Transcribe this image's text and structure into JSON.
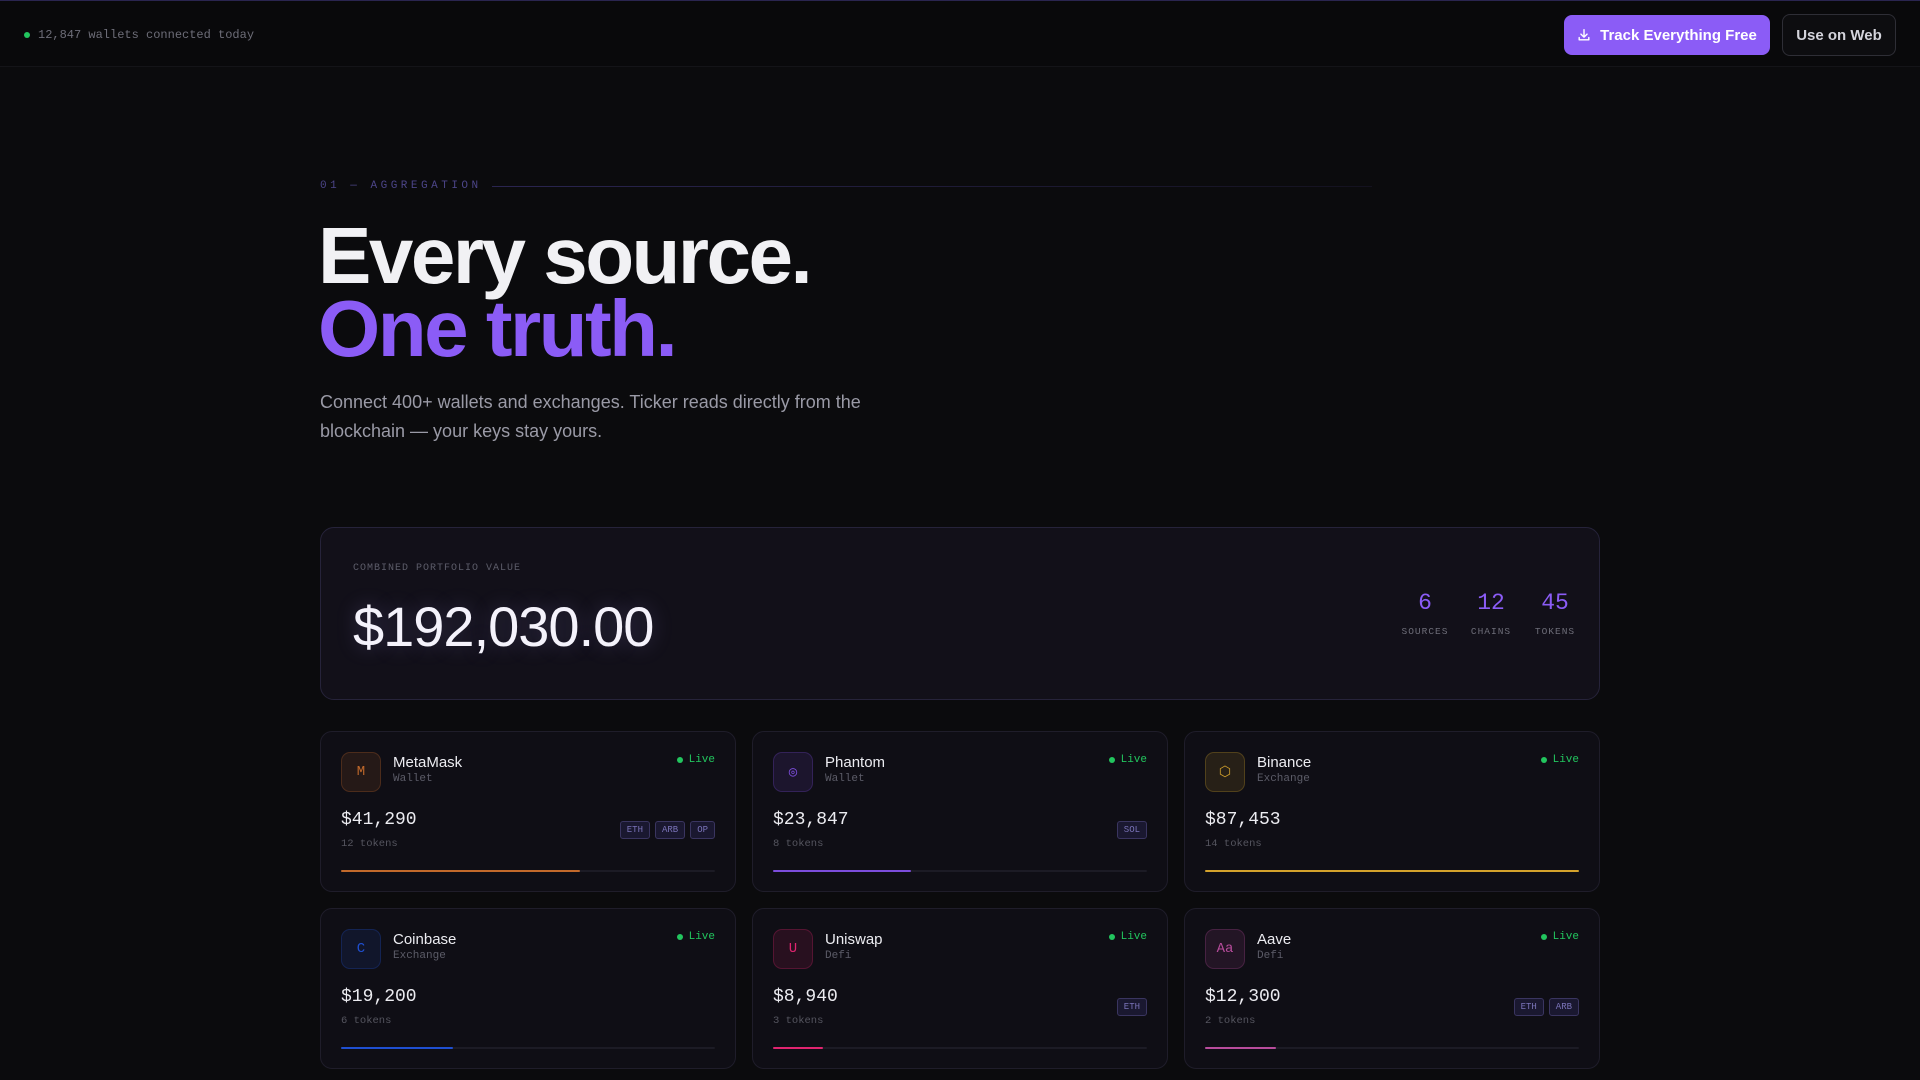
{
  "topbar": {
    "wallets_connected": "12,847 wallets connected today",
    "primary_button": "Track Everything Free",
    "secondary_button": "Use on Web"
  },
  "section": {
    "label": "01 — AGGREGATION"
  },
  "hero": {
    "line1": "Every source.",
    "line2": "One truth.",
    "description": "Connect 400+ wallets and exchanges. Ticker reads directly from the blockchain — your keys stay yours."
  },
  "portfolio": {
    "label": "COMBINED PORTFOLIO VALUE",
    "value": "$192,030.00",
    "stats": [
      {
        "value": "6",
        "label": "SOURCES"
      },
      {
        "value": "12",
        "label": "CHAINS"
      },
      {
        "value": "45",
        "label": "TOKENS"
      }
    ]
  },
  "colors": {
    "accent": "#8b5cf6",
    "live": "#22c55e",
    "background": "#0b0b0d"
  },
  "sources": [
    {
      "name": "MetaMask",
      "type": "Wallet",
      "status": "Live",
      "value": "$41,290",
      "tokens": "12 tokens",
      "chains": [
        "ETH",
        "ARB",
        "OP"
      ],
      "icon_glyph": "M",
      "icon": "metamask-icon",
      "color": "#c2692b",
      "share": 0.64
    },
    {
      "name": "Phantom",
      "type": "Wallet",
      "status": "Live",
      "value": "$23,847",
      "tokens": "8 tokens",
      "chains": [
        "SOL"
      ],
      "icon_glyph": "◎",
      "icon": "phantom-icon",
      "color": "#7c4ddc",
      "share": 0.37
    },
    {
      "name": "Binance",
      "type": "Exchange",
      "status": "Live",
      "value": "$87,453",
      "tokens": "14 tokens",
      "chains": [],
      "icon_glyph": "⬡",
      "icon": "binance-icon",
      "color": "#d4a22c",
      "share": 1.0
    },
    {
      "name": "Coinbase",
      "type": "Exchange",
      "status": "Live",
      "value": "$19,200",
      "tokens": "6 tokens",
      "chains": [],
      "icon_glyph": "C",
      "icon": "coinbase-icon",
      "color": "#1f4fd1",
      "share": 0.3
    },
    {
      "name": "Uniswap",
      "type": "Defi",
      "status": "Live",
      "value": "$8,940",
      "tokens": "3 tokens",
      "chains": [
        "ETH"
      ],
      "icon_glyph": "U",
      "icon": "uniswap-icon",
      "color": "#e0246f",
      "share": 0.135
    },
    {
      "name": "Aave",
      "type": "Defi",
      "status": "Live",
      "value": "$12,300",
      "tokens": "2 tokens",
      "chains": [
        "ETH",
        "ARB"
      ],
      "icon_glyph": "Aa",
      "icon": "aave-icon",
      "color": "#b84c9c",
      "share": 0.19
    }
  ]
}
